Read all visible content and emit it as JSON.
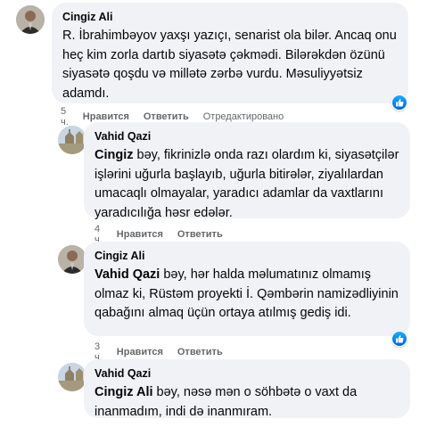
{
  "comments": [
    {
      "author": "Cingiz Ali",
      "text": "R. İbrahimbəyov yaxşı yazıçı, senarist ola bilər. Ancaq onu heç kim zorla dartıb siyasətə çəkmədi. Bilərəkdən özünü siyasətə qoşdu və millətə zərbə vurdu. Məsuliyyətsiz adamdı.",
      "time": "5 ч.",
      "like_label": "Нравится",
      "reply_label": "Ответить",
      "edited_label": "Отредактировано"
    },
    {
      "author": "Vahid Qazi",
      "mention": "Cingiz",
      "text": " bəy, fikrinizlə onda razı olardım ki, siyasətçilər işlərini uğurla başlayıb, uğurla bitirələr, ziyalılardan umacaqlı olmayalar, yaradıcı adamlar da vaxtlarını yaradıcılığa həsr edələr.",
      "time": "4 ч.",
      "like_label": "Нравится",
      "reply_label": "Ответить"
    },
    {
      "author": "Cingiz Ali",
      "mention": "Vahid Qazi",
      "text": " bəy, hər halda məlumatınız olmamış olmaz ki, Rüstəm proyekti İ. Qəmbərin namizədliyinin qabağını almaq üçün ortaya atılmış gediş idi.",
      "time": "3 ч.",
      "like_label": "Нравится",
      "reply_label": "Ответить"
    },
    {
      "author": "Vahid Qazi",
      "mention": "Cingiz Ali",
      "text": " bəy, nəsə mən o söhbətə o vaxt da inanmadım, indi də inanmıram."
    }
  ],
  "icons": {
    "like_reaction": "like-icon",
    "accent": "#1877f2"
  }
}
